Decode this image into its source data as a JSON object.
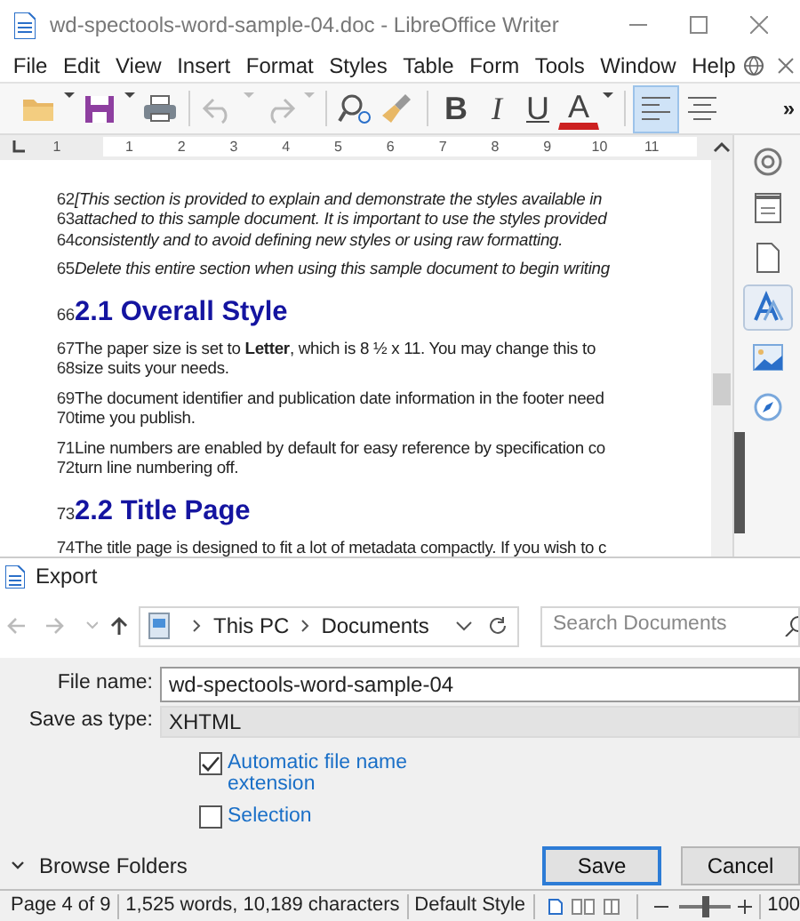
{
  "window": {
    "title": "wd-spectools-word-sample-04.doc - LibreOffice Writer"
  },
  "menu": [
    "File",
    "Edit",
    "View",
    "Insert",
    "Format",
    "Styles",
    "Table",
    "Form",
    "Tools",
    "Window",
    "Help"
  ],
  "toolbar": {
    "format_buttons": [
      {
        "kind": "bold",
        "label": "B"
      },
      {
        "kind": "italic",
        "label": "I"
      },
      {
        "kind": "underline",
        "label": "U"
      },
      {
        "kind": "color",
        "label": "A",
        "color": "#cc2020"
      }
    ],
    "align_buttons": [
      {
        "kind": "left",
        "selected": true
      },
      {
        "kind": "center",
        "selected": false
      }
    ],
    "more": "»"
  },
  "ruler": {
    "labels": [
      "1",
      "1",
      "2",
      "3",
      "4",
      "5",
      "6",
      "7",
      "8",
      "9",
      "10",
      "11"
    ]
  },
  "document": {
    "paragraphs": [
      {
        "kind": "body",
        "italic": true,
        "lines": [
          {
            "number": "62",
            "text": "[This section is provided to explain and demonstrate the styles available in"
          },
          {
            "number": "63",
            "text": "attached to this sample document. It is important to use the styles provided"
          },
          {
            "number": "64",
            "text": "consistently and to avoid defining new styles or using raw formatting."
          }
        ]
      },
      {
        "kind": "body",
        "italic": true,
        "lines": [
          {
            "number": "65",
            "text": "Delete this entire section when using this sample document to begin writing"
          }
        ]
      },
      {
        "kind": "heading",
        "italic": false,
        "lines": [
          {
            "number": "66",
            "text": "2.1 Overall Style"
          }
        ]
      },
      {
        "kind": "body",
        "italic": false,
        "lines": [
          {
            "number": "67",
            "text": "The paper size is set to **Letter**, which is 8 ½ x 11. You may change this to"
          },
          {
            "number": "68",
            "text": "size suits your needs."
          }
        ]
      },
      {
        "kind": "body",
        "italic": false,
        "lines": [
          {
            "number": "69",
            "text": "The document identifier and publication date information in the footer need"
          },
          {
            "number": "70",
            "text": "time you publish."
          }
        ]
      },
      {
        "kind": "body",
        "italic": false,
        "lines": [
          {
            "number": "71",
            "text": "Line numbers are enabled by default for easy reference by specification co"
          },
          {
            "number": "72",
            "text": "turn line numbering off."
          }
        ]
      },
      {
        "kind": "heading",
        "italic": false,
        "lines": [
          {
            "number": "73",
            "text": "2.2 Title Page"
          }
        ]
      },
      {
        "kind": "body",
        "italic": false,
        "lines": [
          {
            "number": "74",
            "text": "The title page is designed to fit a lot of metadata compactly. If you wish to c"
          }
        ]
      }
    ]
  },
  "sidebar": [
    {
      "kind": "properties",
      "selected": false
    },
    {
      "kind": "page",
      "selected": false
    },
    {
      "kind": "styles",
      "selected": true
    },
    {
      "kind": "gallery",
      "selected": false
    },
    {
      "kind": "navigator",
      "selected": false
    }
  ],
  "dialog": {
    "title": "Export",
    "path": [
      "This PC",
      "Documents"
    ],
    "search": {
      "placeholder": "Search Documents"
    },
    "fields": [
      {
        "kind": "input",
        "label": "File name:",
        "value": "wd-spectools-word-sample-04"
      },
      {
        "kind": "select",
        "label": "Save as type:",
        "value": "XHTML"
      }
    ],
    "options": [
      {
        "label": "Automatic file name extension",
        "checked": true
      },
      {
        "label": "Selection",
        "checked": false
      }
    ],
    "browse": "Browse Folders",
    "buttons": [
      {
        "label": "Save",
        "default": true
      },
      {
        "label": "Cancel",
        "default": false
      }
    ]
  },
  "status_bar": {
    "page": "Page 4 of 9",
    "counts": "1,525 words, 10,189 characters",
    "style": "Default Style",
    "zoom": {
      "level": 0.5,
      "reading": "100"
    }
  }
}
